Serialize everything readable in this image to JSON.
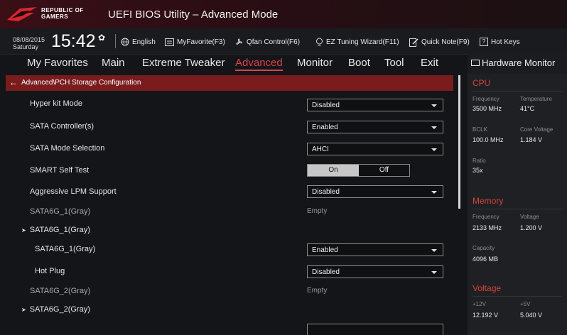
{
  "app": {
    "brand_line1": "REPUBLIC OF",
    "brand_line2": "GAMERS",
    "title": "UEFI BIOS Utility – Advanced Mode"
  },
  "infobar": {
    "date": "08/08/2015",
    "day": "Saturday",
    "time": "15:42",
    "language": "English",
    "myfavorite": "MyFavorite(F3)",
    "qfan": "Qfan Control(F6)",
    "ez_tuning": "EZ Tuning Wizard(F11)",
    "quick_note": "Quick Note(F9)",
    "hot_keys": "Hot Keys"
  },
  "tabs": [
    "My Favorites",
    "Main",
    "Extreme Tweaker",
    "Advanced",
    "Monitor",
    "Boot",
    "Tool",
    "Exit"
  ],
  "active_tab": "Advanced",
  "breadcrumb": "Advanced\\PCH Storage Configuration",
  "rows": {
    "hyper_kit": {
      "label": "Hyper kit Mode",
      "value": "Disabled"
    },
    "sata_ctrl": {
      "label": "SATA Controller(s)",
      "value": "Enabled"
    },
    "sata_mode": {
      "label": "SATA Mode Selection",
      "value": "AHCI"
    },
    "smart": {
      "label": "SMART Self Test",
      "on": "On",
      "off": "Off",
      "state": "On"
    },
    "lpm": {
      "label": "Aggressive LPM Support",
      "value": "Disabled"
    },
    "port1_info": {
      "label": "SATA6G_1(Gray)",
      "value": "Empty"
    },
    "port1_sub": {
      "label": "SATA6G_1(Gray)"
    },
    "port1_enable": {
      "label": "SATA6G_1(Gray)",
      "value": "Enabled"
    },
    "port1_hotplug": {
      "label": "Hot Plug",
      "value": "Disabled"
    },
    "port2_info": {
      "label": "SATA6G_2(Gray)",
      "value": "Empty"
    },
    "port2_sub": {
      "label": "SATA6G_2(Gray)"
    }
  },
  "hardware_monitor": {
    "title": "Hardware Monitor",
    "cpu": {
      "heading": "CPU",
      "frequency_label": "Frequency",
      "frequency": "3500 MHz",
      "temperature_label": "Temperature",
      "temperature": "41°C",
      "bclk_label": "BCLK",
      "bclk": "100.0 MHz",
      "core_voltage_label": "Core Voltage",
      "core_voltage": "1.184 V",
      "ratio_label": "Ratio",
      "ratio": "35x"
    },
    "memory": {
      "heading": "Memory",
      "frequency_label": "Frequency",
      "frequency": "2133 MHz",
      "voltage_label": "Voltage",
      "voltage": "1.200 V",
      "capacity_label": "Capacity",
      "capacity": "4096 MB"
    },
    "voltage": {
      "heading": "Voltage",
      "v12_label": "+12V",
      "v12": "12.192 V",
      "v5_label": "+5V",
      "v5": "5.040 V"
    }
  },
  "colors": {
    "accent": "#d8434b",
    "breadcrumb_bg": "#7a1c1d",
    "background": "#141518",
    "hw_heading": "#d6443c"
  }
}
